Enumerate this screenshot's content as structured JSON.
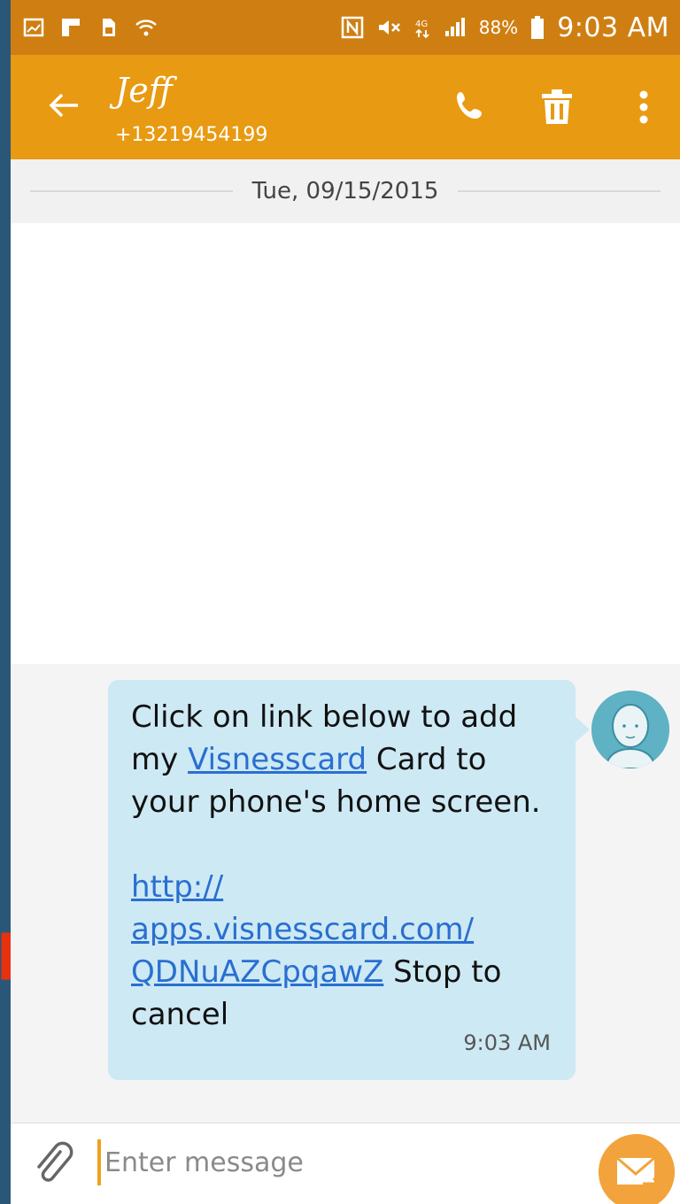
{
  "status_bar": {
    "battery_text": "88%",
    "time": "9:03 AM"
  },
  "header": {
    "contact_name": "Jeff",
    "contact_number": "+13219454199",
    "icons": [
      "back-arrow-icon",
      "phone-icon",
      "trash-icon",
      "more-vert-icon"
    ]
  },
  "conversation": {
    "date": "Tue, 09/15/2015",
    "message": {
      "line1_pre": "Click on link below to add my ",
      "link_word": "Visnesscard",
      "line1_post": " Card to your phone's home screen.",
      "url_part1": "http://",
      "url_part2": "apps.visnesscard.com/",
      "url_part3": "QDNuAZCpqawZ",
      "after_url": " Stop to cancel",
      "time": "9:03 AM"
    }
  },
  "composer": {
    "placeholder": "Enter message"
  },
  "colors": {
    "status_bar": "#cf7f12",
    "app_bar": "#e89a12",
    "bubble": "#cde9f4",
    "link": "#2a6fd0",
    "send_button": "#f2a33c",
    "annotation_arrow": "#e8320f"
  }
}
